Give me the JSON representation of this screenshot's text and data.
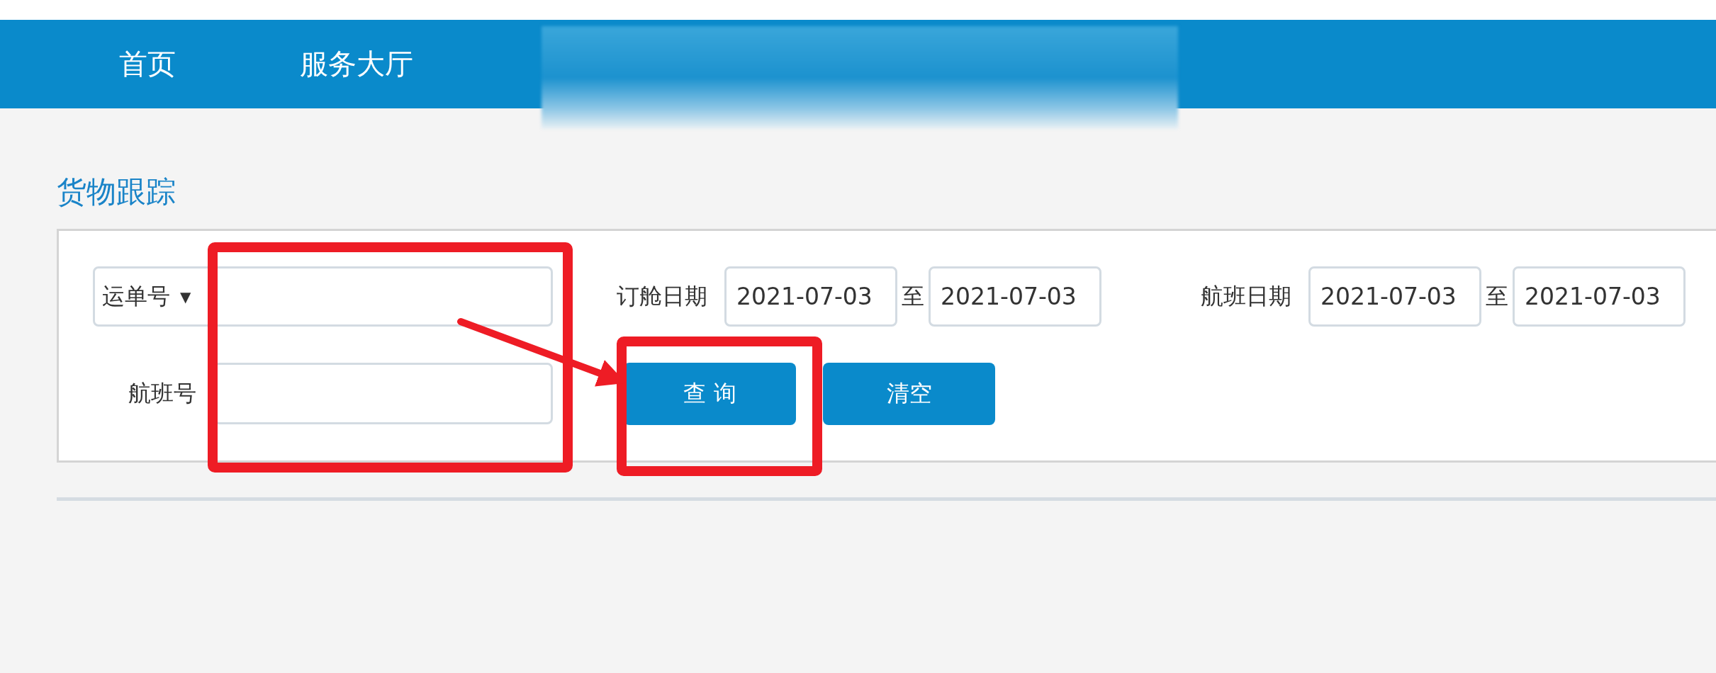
{
  "nav": {
    "items": [
      {
        "label": "首页"
      },
      {
        "label": "服务大厅"
      }
    ]
  },
  "page_title": "货物跟踪",
  "search_form": {
    "waybill": {
      "type_select": "运单号",
      "caret": "▼"
    },
    "booking_date": {
      "label": "订舱日期",
      "from": "2021-07-03",
      "separator": "至",
      "to": "2021-07-03"
    },
    "flight_date": {
      "label": "航班日期",
      "from": "2021-07-03",
      "separator": "至",
      "to": "2021-07-03"
    },
    "flight_no": {
      "label": "航班号"
    },
    "buttons": [
      {
        "label": "查 询"
      },
      {
        "label": "清空"
      }
    ]
  }
}
